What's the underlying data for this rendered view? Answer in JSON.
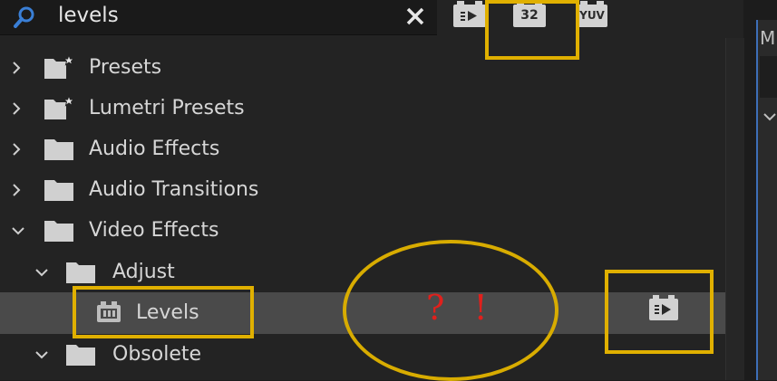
{
  "search": {
    "value": "levels"
  },
  "badges": {
    "accelerated": "",
    "bit32": "32",
    "yuv": "YUV"
  },
  "tree": [
    {
      "label": "Presets",
      "expanded": false,
      "icon": "preset-folder-icon",
      "level": 0
    },
    {
      "label": "Lumetri Presets",
      "expanded": false,
      "icon": "preset-folder-icon",
      "level": 0
    },
    {
      "label": "Audio Effects",
      "expanded": false,
      "icon": "folder-icon",
      "level": 0
    },
    {
      "label": "Audio Transitions",
      "expanded": false,
      "icon": "folder-icon",
      "level": 0
    },
    {
      "label": "Video Effects",
      "expanded": true,
      "icon": "folder-icon",
      "level": 0
    },
    {
      "label": "Adjust",
      "expanded": true,
      "icon": "folder-icon",
      "level": 1
    },
    {
      "label": "Levels",
      "selected": true,
      "icon": "effect-icon",
      "level": 2
    },
    {
      "label": "Obsolete",
      "expanded": true,
      "icon": "folder-icon",
      "level": 1
    }
  ],
  "right_panel": {
    "tab_label": "M"
  },
  "annotation": {
    "text": "? !"
  },
  "colors": {
    "annotation": "#e0b000",
    "alert_text": "#e0201c",
    "accent": "#3d6fb8"
  }
}
